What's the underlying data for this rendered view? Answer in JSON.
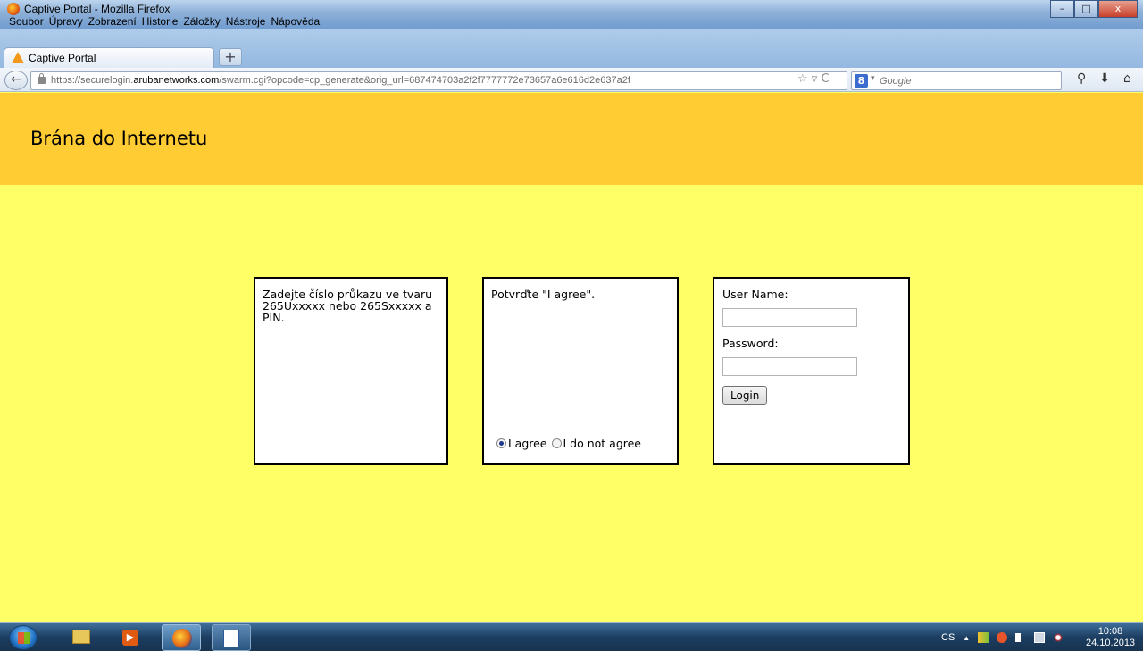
{
  "window": {
    "title": "Captive Portal - Mozilla Firefox",
    "menu": [
      "Soubor",
      "Úpravy",
      "Zobrazení",
      "Historie",
      "Záložky",
      "Nástroje",
      "Nápověda"
    ],
    "controls": {
      "minimize": "–",
      "maximize": "□",
      "close": "x"
    }
  },
  "tabs": [
    {
      "label": "Captive Portal",
      "active": true
    }
  ],
  "new_tab_label": "+",
  "navbar": {
    "back_icon": "←",
    "url_prefix": "https://securelogin.",
    "url_host": "arubanetworks.com",
    "url_path": "/swarm.cgi?opcode=cp_generate&orig_url=687474703a2f2f7777772e73657a6e616d2e637a2f",
    "url_tools": "☆ ▿ C",
    "search_placeholder": "Google",
    "search_engine_icon": "8",
    "search_dropdown_icon": "▾",
    "icons": [
      "search-icon",
      "download-icon",
      "home-icon"
    ],
    "icon_glyphs": [
      "⚲",
      "⬇",
      "⌂"
    ]
  },
  "page": {
    "title": "Brána do Internetu",
    "colors": {
      "header": "#ffcc33",
      "body": "#ffff66"
    },
    "instructions": "Zadejte číslo průkazu ve tvaru 265Uxxxxx nebo 265Sxxxxx a PIN.",
    "terms": {
      "prompt": "Potvrďte \"I agree\".",
      "agree_label": "I agree",
      "disagree_label": "I do not agree",
      "selected": "agree"
    },
    "login": {
      "username_label": "User Name:",
      "username_value": "",
      "password_label": "Password:",
      "password_value": "",
      "submit_label": "Login"
    }
  },
  "taskbar": {
    "apps": [
      "start-button",
      "file-explorer",
      "media-player",
      "firefox",
      "document-app"
    ],
    "tray": {
      "language": "CS",
      "up_arrow": "▲"
    },
    "clock": {
      "time": "10:08",
      "date": "24.10.2013"
    }
  }
}
